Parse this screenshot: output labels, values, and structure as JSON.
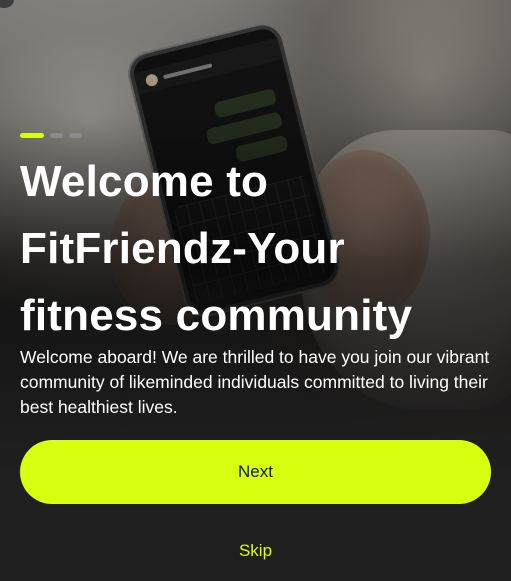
{
  "onboarding": {
    "title": "Welcome to FitFriendz-Your fitness community",
    "description": "Welcome aboard! We are thrilled to have you join our vibrant community of likeminded individuals committed to living their best healthiest lives.",
    "next_label": "Next",
    "skip_label": "Skip",
    "current_page": 1,
    "total_pages": 3
  },
  "colors": {
    "accent": "#d7ff0f",
    "background": "#1f1f1f",
    "text": "#ffffff"
  }
}
